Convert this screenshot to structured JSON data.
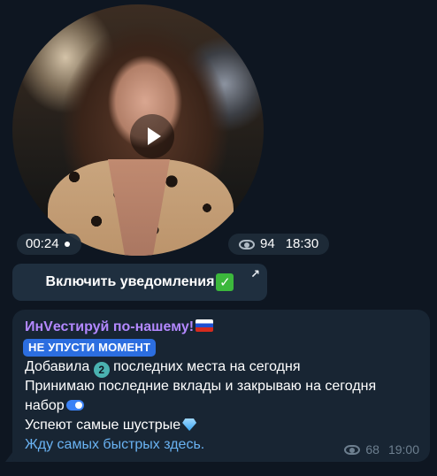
{
  "video_note": {
    "duration": "00:24",
    "views": "94",
    "time": "18:30"
  },
  "notify_button": {
    "label": "Включить уведомления",
    "emoji_icon": "check-mark-emoji"
  },
  "message": {
    "sender": "ИнVестируй по-нашему!",
    "badge": "НЕ УПУСТИ МОМЕНТ",
    "line1_before": "Добавила ",
    "line1_number": "2",
    "line1_after": " последних места на сегодня",
    "line2": "Принимаю последние вклады и закрываю на сегодня",
    "line3": "набор",
    "line4": "Успеют самые шустрые",
    "link": "Жду самых быстрых здесь.",
    "views": "68",
    "time": "19:00"
  },
  "colors": {
    "background": "#0e1621",
    "bubble": "#182533",
    "link": "#6ab3f3",
    "sender": "#b388ff",
    "badge": "#2c6ee0"
  }
}
